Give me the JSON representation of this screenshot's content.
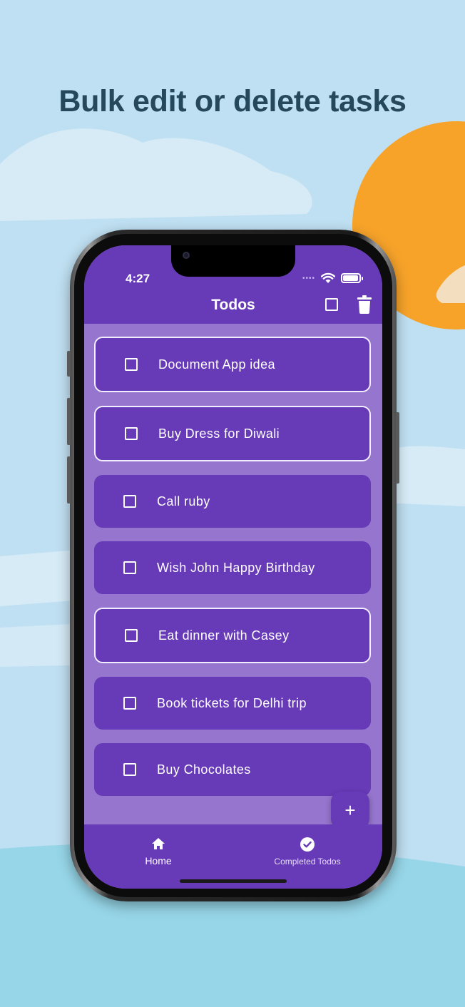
{
  "headline": "Bulk edit or delete tasks",
  "status_bar": {
    "time": "4:27"
  },
  "app_bar": {
    "title": "Todos"
  },
  "todos": [
    {
      "label": "Document App idea",
      "selected": true
    },
    {
      "label": "Buy Dress for Diwali",
      "selected": true
    },
    {
      "label": "Call ruby",
      "selected": false
    },
    {
      "label": "Wish John Happy Birthday",
      "selected": false
    },
    {
      "label": "Eat dinner with Casey",
      "selected": true
    },
    {
      "label": "Book tickets for Delhi trip",
      "selected": false
    },
    {
      "label": "Buy Chocolates",
      "selected": false
    }
  ],
  "fab": {
    "icon": "plus-icon",
    "symbol": "+"
  },
  "bottom_nav": {
    "home": {
      "label": "Home",
      "icon": "home-icon"
    },
    "completed": {
      "label": "Completed Todos",
      "icon": "check-circle-icon"
    }
  },
  "colors": {
    "primary": "#673ab7",
    "list_background": "#9575cd",
    "page_background": "#bfe0f2",
    "sun": "#f7a32a",
    "headline": "#25485a"
  }
}
